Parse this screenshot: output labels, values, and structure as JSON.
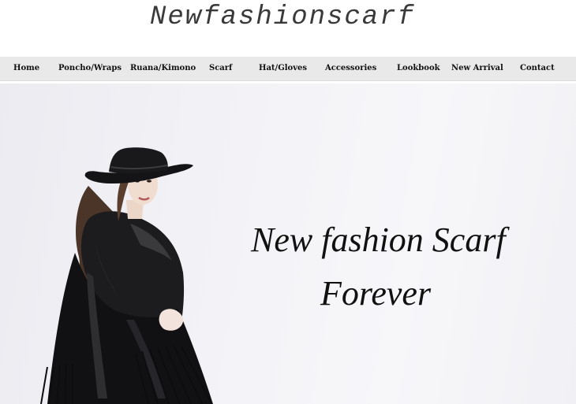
{
  "header": {
    "logo_text": "Newfashionscarf"
  },
  "nav": {
    "items": [
      {
        "label": "Home"
      },
      {
        "label": "Poncho/Wraps"
      },
      {
        "label": "Ruana/Kimono"
      },
      {
        "label": "Scarf"
      },
      {
        "label": "Hat/Gloves"
      },
      {
        "label": "Accessories"
      },
      {
        "label": "Lookbook"
      },
      {
        "label": "New Arrival"
      },
      {
        "label": "Contact"
      }
    ]
  },
  "hero": {
    "line1": "New fashion Scarf",
    "line2": "Forever",
    "image_icon": "model-in-black-hat-and-fringe-poncho"
  },
  "colors": {
    "nav_background": "#e9e9e9",
    "text": "#111111",
    "logo": "#3a3a3a"
  }
}
